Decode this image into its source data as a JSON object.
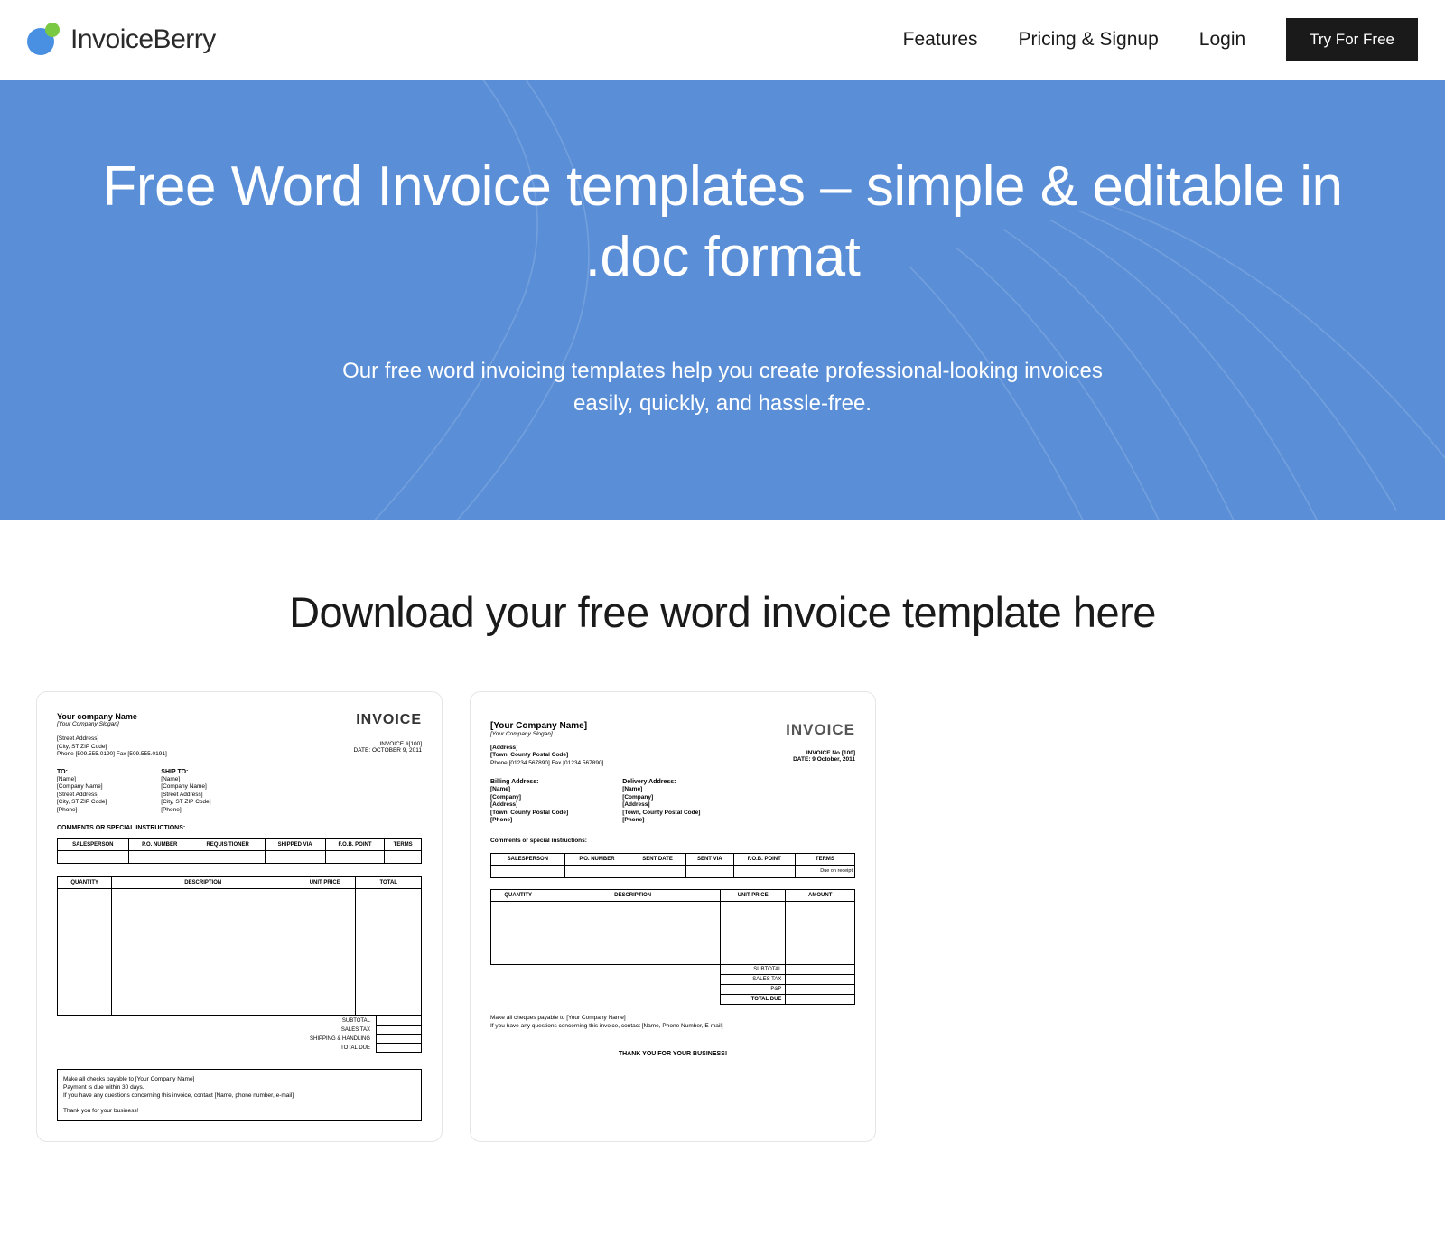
{
  "brand": "InvoiceBerry",
  "nav": {
    "features": "Features",
    "pricing": "Pricing & Signup",
    "login": "Login",
    "cta": "Try For Free"
  },
  "hero": {
    "title": "Free Word Invoice templates – simple & editable in .doc format",
    "subtitle": "Our free word invoicing templates help you create professional-looking invoices easily, quickly, and hassle-free."
  },
  "section": {
    "title": "Download your free word invoice template here"
  },
  "template1": {
    "company": "Your company Name",
    "slogan": "[Your Company Slogan]",
    "title": "INVOICE",
    "addr1": "[Street Address]",
    "addr2": "[City, ST  ZIP Code]",
    "phone": "Phone [509.555.0190]  Fax [509.555.0191]",
    "meta1": "INVOICE #[100]",
    "meta2": "DATE: OCTOBER 9, 2011",
    "to_label": "TO:",
    "ship_label": "SHIP TO:",
    "to_name": "[Name]",
    "to_company": "[Company Name]",
    "to_street": "[Street Address]",
    "to_city": "[City, ST  ZIP Code]",
    "to_phone": "[Phone]",
    "ship_name": "[Name]",
    "ship_company": "[Company Name]",
    "ship_street": "[Street Address]",
    "ship_city": "[City, ST  ZIP Code]",
    "ship_phone": "[Phone]",
    "comments": "COMMENTS OR SPECIAL INSTRUCTIONS:",
    "h_salesperson": "SALESPERSON",
    "h_po": "P.O. NUMBER",
    "h_req": "REQUISITIONER",
    "h_ship": "SHIPPED VIA",
    "h_fob": "F.O.B. POINT",
    "h_terms": "TERMS",
    "i_qty": "QUANTITY",
    "i_desc": "DESCRIPTION",
    "i_unit": "UNIT PRICE",
    "i_total": "TOTAL",
    "t_subtotal": "SUBTOTAL",
    "t_tax": "SALES TAX",
    "t_ship": "SHIPPING & HANDLING",
    "t_due": "TOTAL DUE",
    "f1": "Make all checks payable to [Your Company Name]",
    "f2": "Payment is due within 30 days.",
    "f3": "If you have any questions concerning this invoice, contact [Name, phone number, e-mail]",
    "f4": "Thank you for your business!"
  },
  "template2": {
    "company": "[Your Company Name]",
    "slogan": "[Your Company Slogan]",
    "title": "INVOICE",
    "addr1": "[Address]",
    "addr2": "[Town, County  Postal Code]",
    "phone": "Phone [01234 567890] Fax [01234 567890]",
    "meta1": "INVOICE No [100]",
    "meta2": "DATE:  9 October, 2011",
    "bill_label": "Billing Address:",
    "del_label": "Delivery Address:",
    "b_name": "[Name]",
    "b_company": "[Company]",
    "b_addr": "[Address]",
    "b_town": "[Town, County  Postal Code]",
    "b_phone": "[Phone]",
    "d_name": "[Name]",
    "d_company": "[Company]",
    "d_addr": "[Address]",
    "d_town": "[Town, County  Postal Code]",
    "d_phone": "[Phone]",
    "comments": "Comments or special instructions:",
    "h_salesperson": "SALESPERSON",
    "h_po": "P.O. NUMBER",
    "h_sent_date": "SENT DATE",
    "h_sent_via": "SENT VIA",
    "h_fob": "F.O.B. POINT",
    "h_terms": "TERMS",
    "terms_note": "Due on receipt",
    "i_qty": "QUANTITY",
    "i_desc": "DESCRIPTION",
    "i_unit": "UNIT PRICE",
    "i_amt": "AMOUNT",
    "t_subtotal": "SUBTOTAL",
    "t_tax": "SALES TAX",
    "t_pp": "P&P",
    "t_due": "TOTAL DUE",
    "f1": "Make all cheques payable to [Your Company Name]",
    "f2": "If you have any questions concerning this invoice, contact [Name, Phone Number, E-mail]",
    "thanks": "THANK YOU FOR YOUR BUSINESS!"
  }
}
